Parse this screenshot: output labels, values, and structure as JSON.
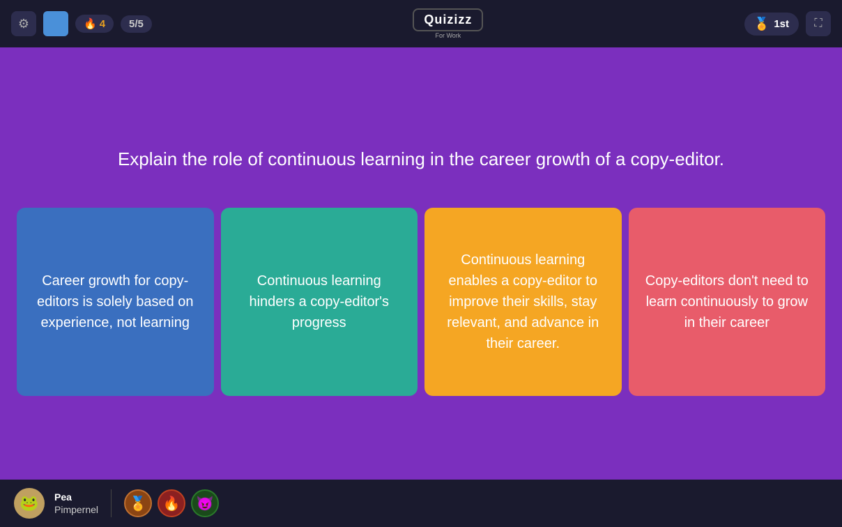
{
  "topbar": {
    "streak": "4",
    "progress": "5/5",
    "logo": "Quizizz",
    "logo_sub": "For Work",
    "rank": "1st",
    "gear_icon": "⚙",
    "fullscreen_icon": "⛶",
    "rank_icon": "🏅"
  },
  "question": {
    "text": "Explain the role of continuous learning in the career growth of a copy-editor."
  },
  "answers": [
    {
      "id": "a",
      "text": "Career growth for copy-editors is solely based on experience, not learning",
      "color": "answer-blue"
    },
    {
      "id": "b",
      "text": "Continuous learning hinders a copy-editor's progress",
      "color": "answer-teal"
    },
    {
      "id": "c",
      "text": "Continuous learning enables a copy-editor to improve their skills, stay relevant, and advance in their career.",
      "color": "answer-yellow"
    },
    {
      "id": "d",
      "text": "Copy-editors don't need to learn continuously to grow in their career",
      "color": "answer-red"
    }
  ],
  "player": {
    "name_first": "Pea",
    "name_last": "Pimpernel",
    "avatar_emoji": "🐸",
    "badges": [
      "🏅",
      "🔥",
      "😈"
    ]
  }
}
